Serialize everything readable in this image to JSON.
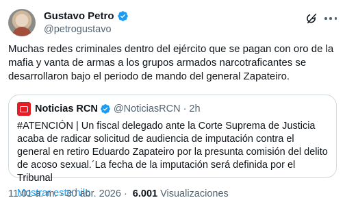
{
  "author": {
    "display_name": "Gustavo Petro",
    "handle": "@petrogustavo"
  },
  "tweet": {
    "text": "Muchas redes criminales dentro del ejército que se pagan con oro de la mafia y vanta de armas a los grupos armados narcotraficantes se desarrollaron bajo el periodo de mando del general Zapateiro."
  },
  "quote": {
    "display_name": "Noticias RCN",
    "handle": "@NoticiasRCN",
    "dot": "·",
    "time": "2h",
    "text": "#ATENCIÓN | Un fiscal delegado ante la Corte Suprema de Justicia acaba de radicar solicitud de audiencia de imputación contra el general en retiro Eduardo Zapateiro por la presunta comisión del delito de acoso sexual.´La fecha de la imputación será definida por el Tribunal",
    "show_thread": "Mostrar este hilo"
  },
  "meta": {
    "time": "11:01 a. m.",
    "separator": "·",
    "date": "30 abr. 2026",
    "views_count": "6.001",
    "views_label": "Visualizaciones"
  },
  "colors": {
    "verified_blue": "#1d9bf0",
    "link_blue": "#1d9bf0",
    "rcn_red": "#e21f26",
    "secondary_text": "#536471"
  },
  "icons": {
    "verified": "verified-badge-icon",
    "grok": "grok-icon",
    "more": "more-horizontal-icon"
  }
}
